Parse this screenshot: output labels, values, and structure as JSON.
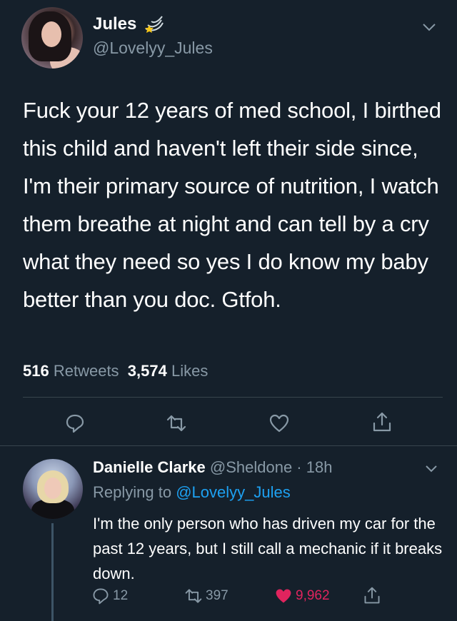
{
  "tweet": {
    "author": {
      "name": "Jules",
      "handle": "@Lovelyy_Jules",
      "name_icon": "comet-icon"
    },
    "text": "Fuck your 12 years of med school, I birthed this child and haven't left their side since, I'm their primary source of nutrition, I watch them breathe at night and can tell by a cry what they need so yes I do know my baby better than you doc. Gtfoh.",
    "stats": {
      "retweets_count": "516",
      "retweets_label": "Retweets",
      "likes_count": "3,574",
      "likes_label": "Likes"
    },
    "actions": [
      "reply-icon",
      "retweet-icon",
      "like-icon",
      "share-icon"
    ]
  },
  "reply": {
    "author": {
      "name": "Danielle Clarke",
      "handle": "@Sheldone",
      "time": "18h"
    },
    "replying_to_label": "Replying to",
    "replying_to_handle": "@Lovelyy_Jules",
    "text": "I'm the only person who has driven my car for the past 12 years, but I still call a mechanic if it breaks down.",
    "metrics": {
      "replies": "12",
      "retweets": "397",
      "likes": "9,962",
      "liked": true
    }
  },
  "colors": {
    "background": "#15202b",
    "text": "#ffffff",
    "secondary": "#8899a6",
    "link": "#1da1f2",
    "like": "#e0245e",
    "divider": "#38444d"
  }
}
